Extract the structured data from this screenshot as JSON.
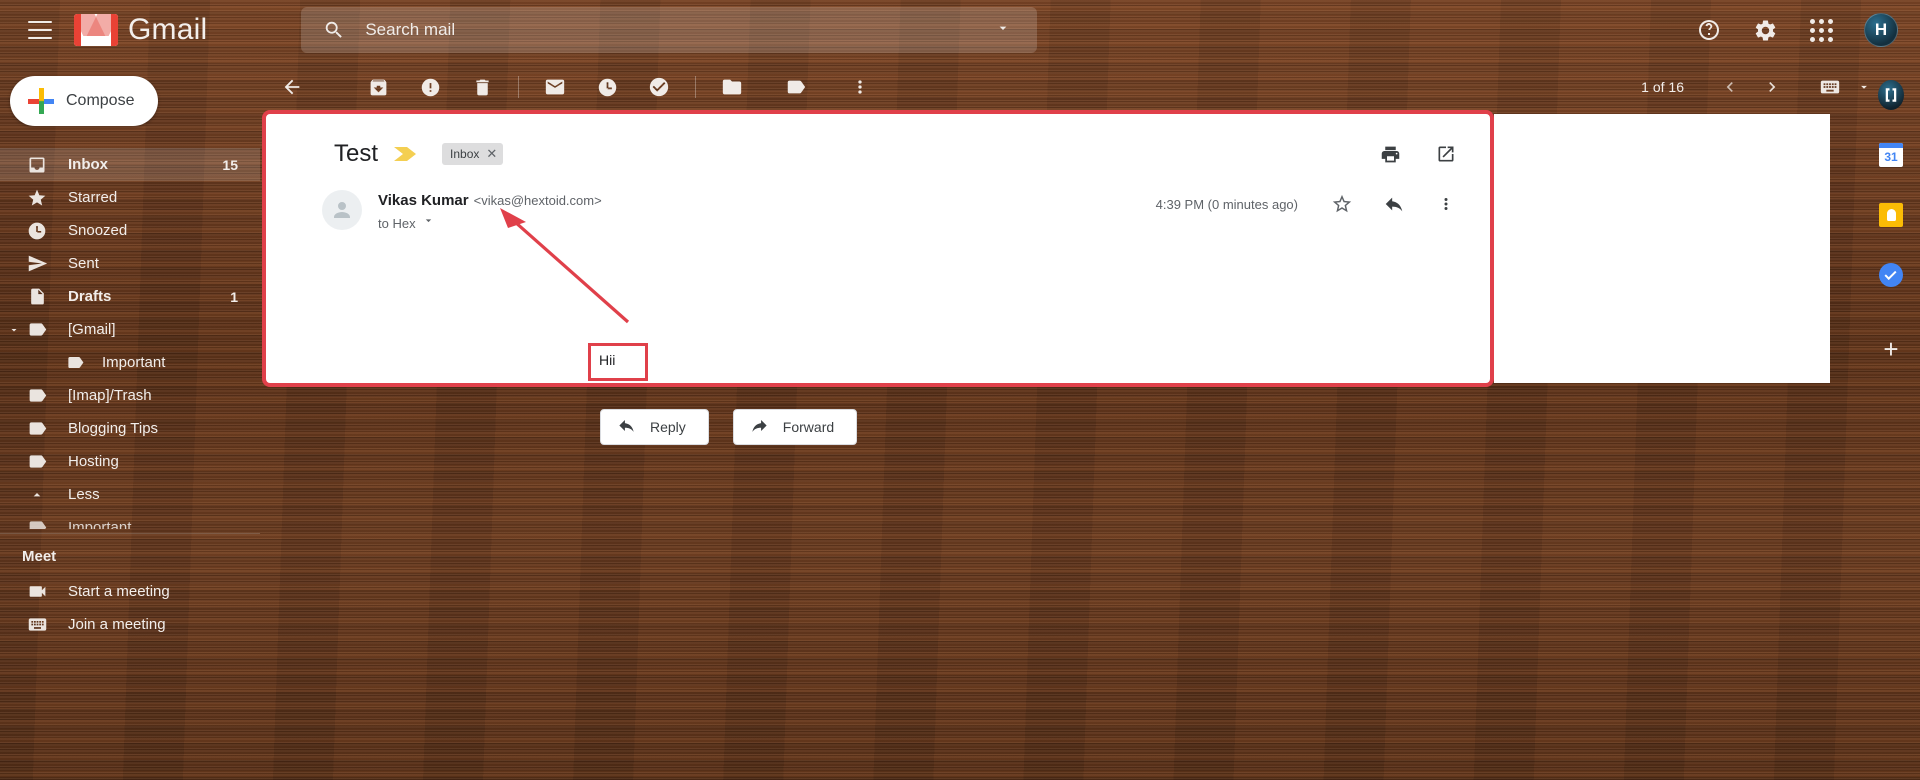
{
  "header": {
    "menu_icon": "hamburger-menu-icon",
    "logo_text": "Gmail",
    "search": {
      "placeholder": "Search mail",
      "icon": "search-icon",
      "options_icon": "chevron-down-icon"
    },
    "help_icon": "help-icon",
    "settings_icon": "gear-icon",
    "apps_icon": "apps-grid-icon",
    "avatar_initial": "H"
  },
  "sidebar": {
    "compose_label": "Compose",
    "items": [
      {
        "label": "Inbox",
        "icon": "inbox-icon",
        "count": "15",
        "active": true,
        "bold": true
      },
      {
        "label": "Starred",
        "icon": "star-icon",
        "count": "",
        "active": false,
        "bold": false
      },
      {
        "label": "Snoozed",
        "icon": "clock-icon",
        "count": "",
        "active": false,
        "bold": false
      },
      {
        "label": "Sent",
        "icon": "send-icon",
        "count": "",
        "active": false,
        "bold": false
      },
      {
        "label": "Drafts",
        "icon": "draft-icon",
        "count": "1",
        "active": false,
        "bold": true
      },
      {
        "label": "[Gmail]",
        "icon": "label-icon",
        "count": "",
        "active": false,
        "bold": false
      },
      {
        "label": "Important",
        "icon": "label-icon",
        "count": "",
        "active": false,
        "bold": false
      },
      {
        "label": "[Imap]/Trash",
        "icon": "label-icon",
        "count": "",
        "active": false,
        "bold": false
      },
      {
        "label": "Blogging Tips",
        "icon": "label-icon",
        "count": "",
        "active": false,
        "bold": false
      },
      {
        "label": "Hosting",
        "icon": "label-icon",
        "count": "",
        "active": false,
        "bold": false
      },
      {
        "label": "Less",
        "icon": "chevron-up-icon",
        "count": "",
        "active": false,
        "bold": false
      },
      {
        "label": "Important",
        "icon": "label-icon",
        "count": "",
        "active": false,
        "bold": false
      }
    ],
    "meet": {
      "title": "Meet",
      "items": [
        {
          "label": "Start a meeting",
          "icon": "video-camera-icon"
        },
        {
          "label": "Join a meeting",
          "icon": "keyboard-icon"
        }
      ]
    }
  },
  "toolbar": {
    "buttons": [
      {
        "name": "back-to-inbox-button",
        "icon": "arrow-left-icon"
      },
      {
        "name": "archive-button",
        "icon": "archive-icon"
      },
      {
        "name": "report-spam-button",
        "icon": "exclamation-icon"
      },
      {
        "name": "delete-button",
        "icon": "trash-icon"
      },
      {
        "name": "mark-as-unread-button",
        "icon": "envelope-icon"
      },
      {
        "name": "snooze-button",
        "icon": "clock-icon"
      },
      {
        "name": "add-to-tasks-button",
        "icon": "task-check-icon"
      },
      {
        "name": "move-to-button",
        "icon": "folder-icon"
      },
      {
        "name": "labels-button",
        "icon": "label-icon"
      },
      {
        "name": "more-options-button",
        "icon": "more-vertical-icon"
      }
    ],
    "pagination": {
      "text": "1 of 16",
      "prev_icon": "chevron-left-icon",
      "next_icon": "chevron-right-icon",
      "input_tools_icon": "keyboard-icon",
      "input_tools_caret": "chevron-down-icon"
    }
  },
  "email": {
    "subject": "Test",
    "importance_marker_icon": "importance-marker-icon",
    "label_chip": {
      "text": "Inbox",
      "remove_icon": "close-icon"
    },
    "print_icon": "printer-icon",
    "popout_icon": "open-in-new-icon",
    "sender_name": "Vikas Kumar",
    "sender_email": "<vikas@hextoid.com>",
    "recipient": "to Hex",
    "recipient_caret_icon": "chevron-down-icon",
    "timestamp": "4:39 PM (0 minutes ago)",
    "star_icon": "star-outline-icon",
    "reply_icon": "reply-arrow-icon",
    "more_icon": "more-vertical-icon",
    "body": "Hii",
    "actions": [
      {
        "label": "Reply",
        "icon": "reply-arrow-icon"
      },
      {
        "label": "Forward",
        "icon": "forward-arrow-icon"
      }
    ]
  },
  "right_rail": {
    "items": [
      {
        "name": "profile-badge-icon"
      },
      {
        "name": "google-calendar-icon",
        "day": "31"
      },
      {
        "name": "google-keep-icon"
      },
      {
        "name": "google-tasks-icon"
      },
      {
        "name": "add-on-button",
        "label": "+"
      }
    ]
  },
  "annotations": {
    "accent_color": "#e0404a",
    "arrow_name": "red-pointer-arrow",
    "body_highlight_name": "red-highlight-box",
    "frame_name": "red-highlight-frame"
  }
}
